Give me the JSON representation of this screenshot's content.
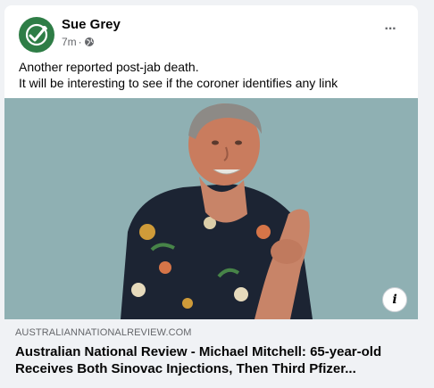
{
  "post": {
    "author": "Sue Grey",
    "time": "7m",
    "separator": "·",
    "text_lines": [
      "Another reported post-jab death.",
      "It will be interesting to see if the coroner identifies any link"
    ],
    "more_options": "···"
  },
  "link_preview": {
    "domain": "AUSTRALIANNATIONALREVIEW.COM",
    "headline_lines": [
      "Australian National Review - Michael Mitchell: 65-year-old",
      "Receives Both Sinovac Injections, Then Third Pfizer..."
    ],
    "info_label": "i"
  },
  "colors": {
    "avatar_bg": "#2e7d46",
    "image_bg": "#8fb0b3",
    "shirt": "#1c2433"
  },
  "icons": {
    "avatar": "checkmark-leaf-icon",
    "privacy": "globe-icon",
    "menu": "more-horizontal-icon",
    "info": "info-icon"
  }
}
